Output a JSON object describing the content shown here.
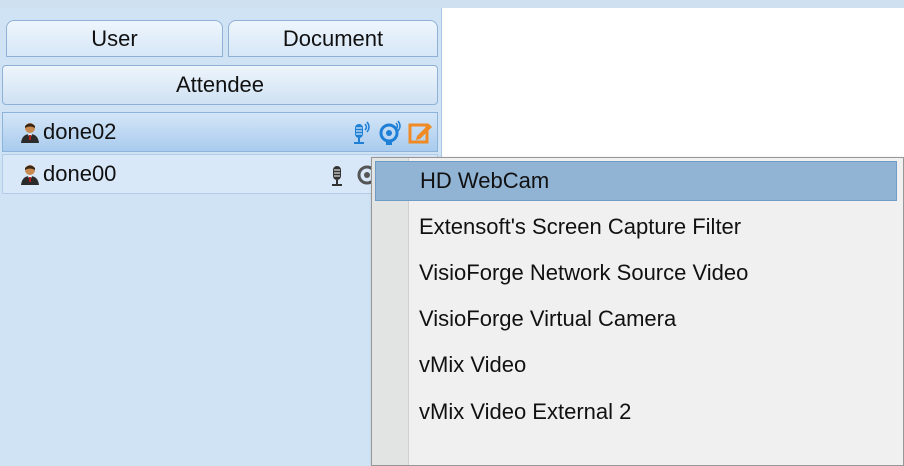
{
  "tabs": [
    {
      "label": "User"
    },
    {
      "label": "Document"
    }
  ],
  "panel_header": "Attendee",
  "attendees": [
    {
      "name": "done02",
      "mic": "mic-active-icon",
      "cam": "webcam-active-icon",
      "edit": "edit-icon",
      "selected": true
    },
    {
      "name": "done00",
      "mic": "mic-inactive-icon",
      "cam": "webcam-inactive-icon",
      "selected": false
    }
  ],
  "context_menu": {
    "items": [
      {
        "label": "HD WebCam",
        "highlighted": true
      },
      {
        "label": "Extensoft's Screen Capture Filter"
      },
      {
        "label": "VisioForge Network Source Video"
      },
      {
        "label": "VisioForge Virtual Camera"
      },
      {
        "label": "vMix Video"
      },
      {
        "label": "vMix Video External 2"
      }
    ]
  },
  "colors": {
    "panel_bg": "#cfe3f5",
    "selected_row": "#a9cbee",
    "menu_highlight": "#91b3d4",
    "active_icon_blue": "#1e7fd6",
    "edit_orange": "#f08a24"
  }
}
